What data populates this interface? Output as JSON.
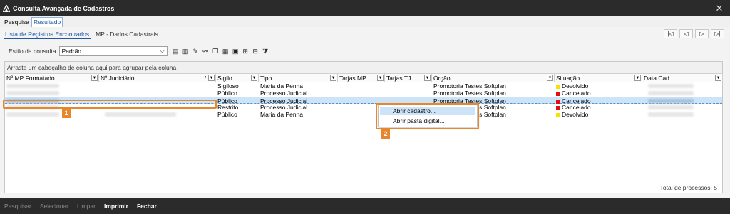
{
  "window": {
    "title": "Consulta Avançada de Cadastros",
    "minimize": "—",
    "close": "✕"
  },
  "outer_tabs": [
    {
      "label": "Pesquisa",
      "active": false
    },
    {
      "label": "Resultado",
      "active": true
    }
  ],
  "inner_tabs": [
    {
      "label": "Lista de Registros Encontrados",
      "active": true
    },
    {
      "label": "MP - Dados Cadastrais",
      "active": false
    }
  ],
  "nav": {
    "first": "|◁",
    "prev": "◁",
    "next": "▷",
    "last": "▷|"
  },
  "toolbar": {
    "style_label": "Estilo da consulta",
    "style_value": "Padrão"
  },
  "grid": {
    "group_hint": "Arraste um cabeçalho de coluna aqui para agrupar pela coluna",
    "columns": [
      "Nº MP Formatado",
      "Nº Judiciário",
      "Sigilo",
      "Tipo",
      "Tarjas MP",
      "Tarjas TJ",
      "Órgão",
      "Situação",
      "Data Cad."
    ],
    "rows": [
      {
        "sigilo": "Sigiloso",
        "tipo": "Maria da Penha",
        "orgao": "Promotoria Testes Softplan",
        "situacao": "Devolvido",
        "status_color": "#f5e400",
        "has_judicial": false,
        "selected": false
      },
      {
        "sigilo": "Público",
        "tipo": "Processo Judicial",
        "orgao": "Promotoria Testes Softplan",
        "situacao": "Cancelado",
        "status_color": "#e01010",
        "has_judicial": false,
        "selected": false
      },
      {
        "sigilo": "Público",
        "tipo": "Processo Judicial",
        "orgao": "Promotoria Testes Softplan",
        "situacao": "Cancelado",
        "status_color": "#e01010",
        "has_judicial": false,
        "selected": true
      },
      {
        "sigilo": "Restrito",
        "tipo": "Processo Judicial",
        "orgao": "Promotoria Testes Softplan",
        "situacao": "Cancelado",
        "status_color": "#e01010",
        "has_judicial": false,
        "selected": false
      },
      {
        "sigilo": "Público",
        "tipo": "Maria da Penha",
        "orgao": "Promotoria Testes Softplan",
        "situacao": "Devolvido",
        "status_color": "#f5e400",
        "has_judicial": true,
        "selected": false
      }
    ],
    "total": "Total de processos: 5"
  },
  "context_menu": [
    "Abrir cadastro...",
    "Abrir pasta digital..."
  ],
  "callouts": [
    "1",
    "2"
  ],
  "bottom_buttons": [
    {
      "label": "Pesquisar",
      "enabled": false
    },
    {
      "label": "Selecionar",
      "enabled": false
    },
    {
      "label": "Limpar",
      "enabled": false
    },
    {
      "label": "Imprimir",
      "enabled": true
    },
    {
      "label": "Fechar",
      "enabled": true
    }
  ],
  "colors": {
    "accent": "#1e5aa8",
    "callout": "#e8862c",
    "selection": "#cde3f7",
    "chrome": "#2b2b2b"
  }
}
